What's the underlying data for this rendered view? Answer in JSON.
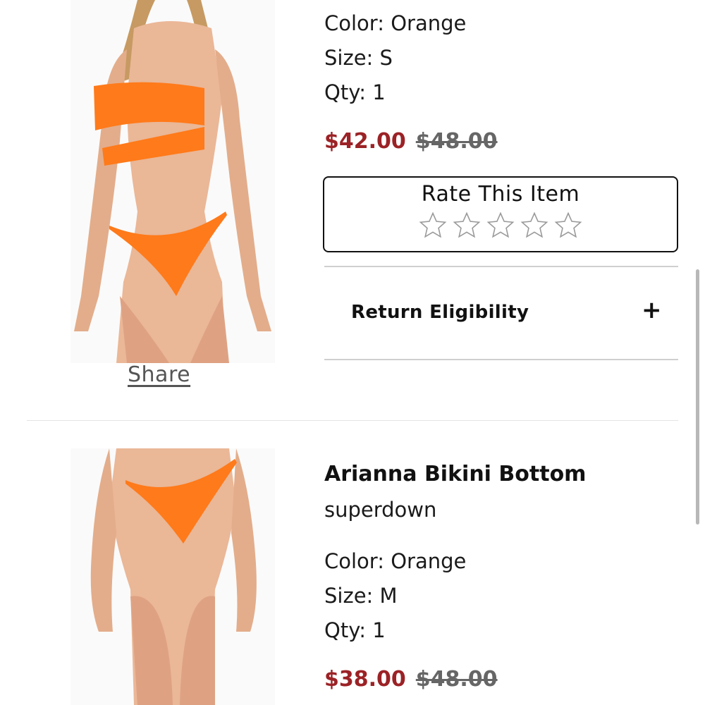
{
  "item1": {
    "color": "Color: Orange",
    "size": "Size: S",
    "qty": "Qty: 1",
    "sale_price": "$42.00",
    "original_price": "$48.00",
    "share_label": "Share",
    "rate_label": "Rate This Item",
    "rating": 0,
    "rating_max": 5,
    "return_label": "Return Eligibility",
    "expand_symbol": "+"
  },
  "item2": {
    "title": "Arianna Bikini Bottom",
    "brand": "superdown",
    "color": "Color: Orange",
    "size": "Size: M",
    "qty": "Qty: 1",
    "sale_price": "$38.00",
    "original_price": "$48.00"
  },
  "colors": {
    "sale_price": "#9b2226",
    "swim_orange": "#ff7a1a",
    "skin": "#eab797"
  }
}
